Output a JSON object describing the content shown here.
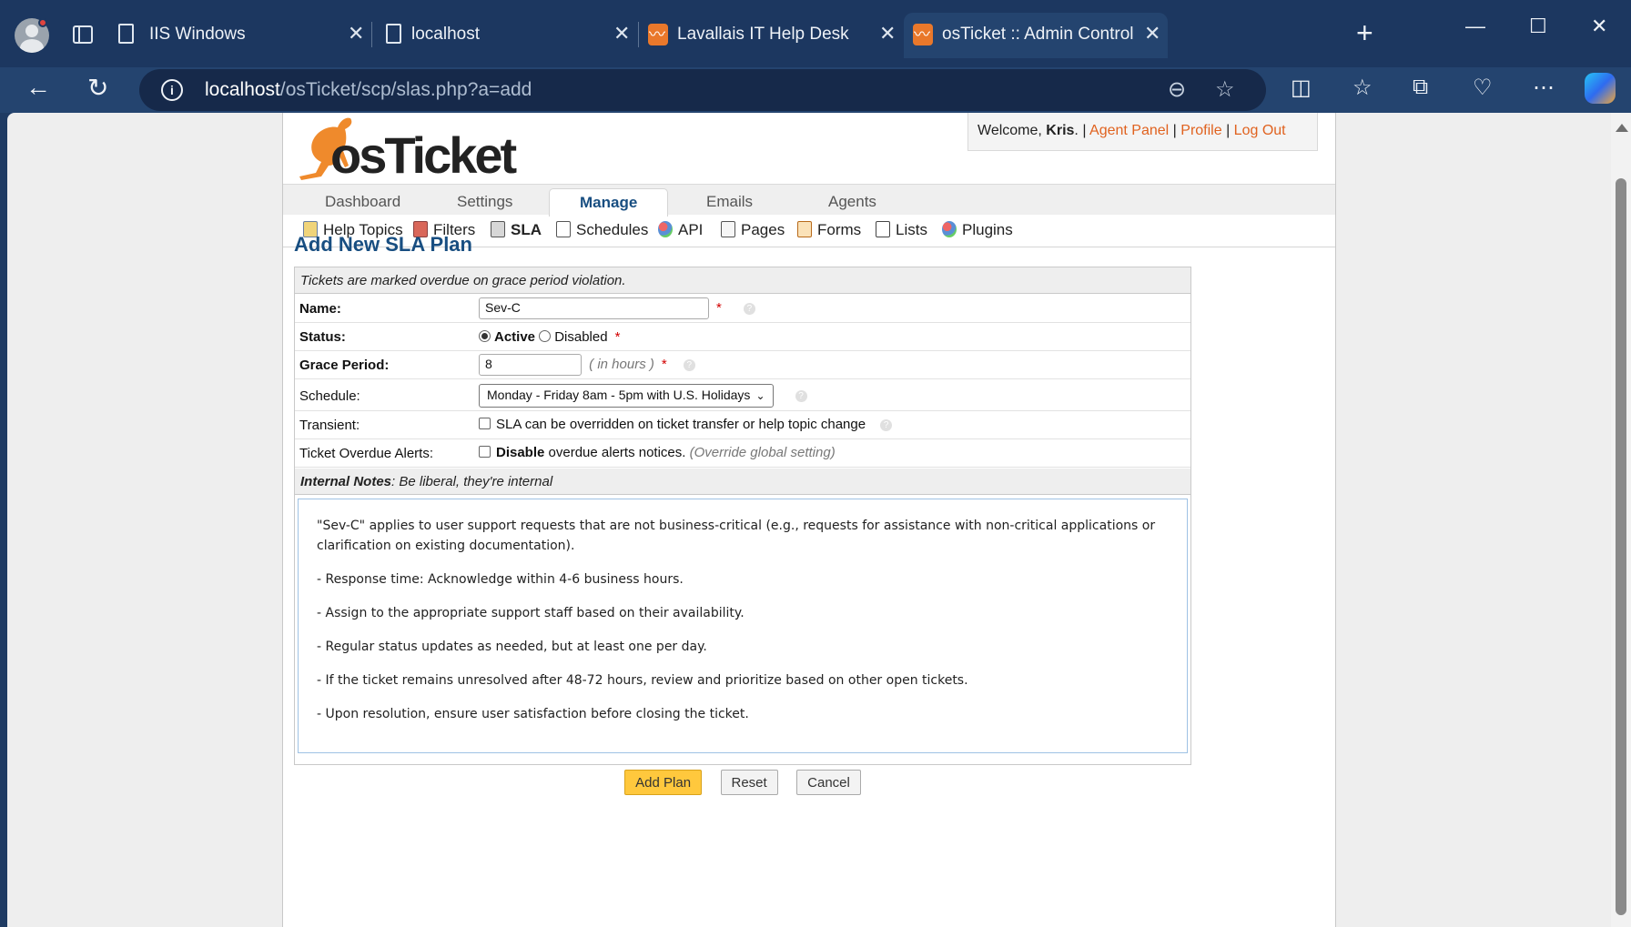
{
  "browser": {
    "tabs": [
      {
        "title": "IIS Windows",
        "icon": "document-icon",
        "active": false
      },
      {
        "title": "localhost",
        "icon": "document-error-icon",
        "active": false
      },
      {
        "title": "Lavallais IT Help Desk",
        "icon": "osticket-kangaroo-icon",
        "active": false
      },
      {
        "title": "osTicket :: Admin Control Pane",
        "icon": "osticket-kangaroo-icon",
        "active": true
      }
    ],
    "url_host": "localhost",
    "url_path": "/osTicket/scp/slas.php?a=add"
  },
  "header": {
    "logo_text": "osTicket",
    "welcome": "Welcome,",
    "user": "Kris",
    "links": [
      "Agent Panel",
      "Profile",
      "Log Out"
    ]
  },
  "nav": {
    "tabs": [
      "Dashboard",
      "Settings",
      "Manage",
      "Emails",
      "Agents"
    ],
    "active": "Manage"
  },
  "subnav": {
    "items": [
      "Help Topics",
      "Filters",
      "SLA",
      "Schedules",
      "API",
      "Pages",
      "Forms",
      "Lists",
      "Plugins"
    ],
    "active": "SLA"
  },
  "page": {
    "title": "Add New SLA Plan",
    "info": "Tickets are marked overdue on grace period violation."
  },
  "form": {
    "name_label": "Name:",
    "name_value": "Sev-C",
    "status_label": "Status:",
    "status_active": "Active",
    "status_disabled": "Disabled",
    "grace_label": "Grace Period:",
    "grace_value": "8",
    "grace_unit": "( in hours )",
    "schedule_label": "Schedule:",
    "schedule_value": "Monday - Friday 8am - 5pm with U.S. Holidays",
    "transient_label": "Transient:",
    "transient_text": "SLA can be overridden on ticket transfer or help topic change",
    "alerts_label": "Ticket Overdue Alerts:",
    "alerts_bold": "Disable",
    "alerts_text": "overdue alerts notices.",
    "alerts_note": "(Override global setting)",
    "required_mark": "*"
  },
  "notes": {
    "heading": "Internal Notes",
    "subheading": ": Be liberal, they're internal",
    "paragraphs": [
      "\"Sev-C\" applies to user support requests that are not business-critical (e.g., requests for assistance with non-critical applications or clarification on existing documentation).",
      "- Response time: Acknowledge within 4-6 business hours.",
      "- Assign to the appropriate support staff based on their availability.",
      "- Regular status updates as needed, but at least one per day.",
      "- If the ticket remains unresolved after 48-72 hours, review and prioritize based on other open tickets.",
      "- Upon resolution, ensure user satisfaction before closing the ticket."
    ]
  },
  "buttons": {
    "add": "Add Plan",
    "reset": "Reset",
    "cancel": "Cancel"
  },
  "colors": {
    "accent": "#184e81",
    "link": "#e0621f",
    "primary_button": "#ffc83d"
  }
}
